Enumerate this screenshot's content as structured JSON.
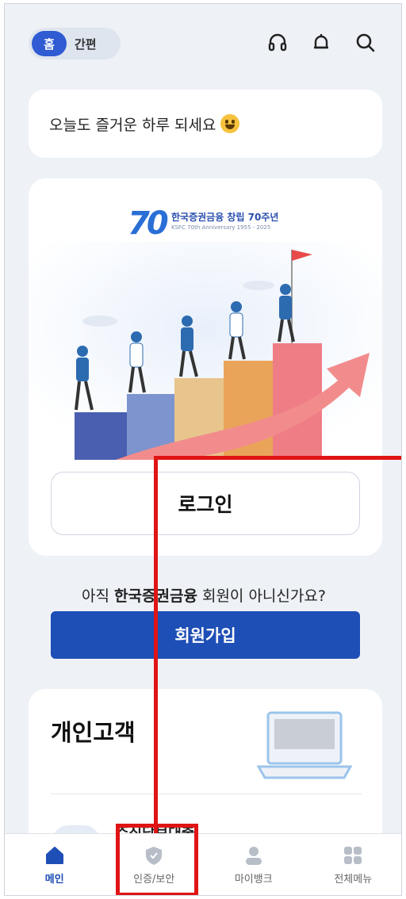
{
  "header": {
    "toggle_active": "홈",
    "toggle_inactive": "간편",
    "icons": [
      "headset-icon",
      "bell-icon",
      "search-icon"
    ]
  },
  "greeting": {
    "text": "오늘도 즐거운 하루 되세요",
    "emoji": "grinning-face"
  },
  "banner": {
    "logo_number": "70",
    "logo_title": "한국증권금융 창립 70주년",
    "logo_subtitle": "KSFC 70th Anniversary 1955 - 2025",
    "login_label": "로그인"
  },
  "signup": {
    "prompt_pre": "아직 ",
    "prompt_brand": "한국증권금융",
    "prompt_post": " 회원이 아니신가요?",
    "button_label": "회원가입"
  },
  "personal": {
    "title": "개인고객",
    "first_item_label": "주식담보대출"
  },
  "nav": {
    "items": [
      {
        "label": "메인",
        "icon": "home-icon",
        "active": true
      },
      {
        "label": "인증/보안",
        "icon": "shield-icon",
        "active": false
      },
      {
        "label": "마이뱅크",
        "icon": "person-icon",
        "active": false
      },
      {
        "label": "전체메뉴",
        "icon": "grid-icon",
        "active": false
      }
    ]
  },
  "colors": {
    "primary": "#1e4fb6",
    "accent": "#2f5bd3",
    "highlight": "#e01414",
    "background": "#eef1f6"
  }
}
